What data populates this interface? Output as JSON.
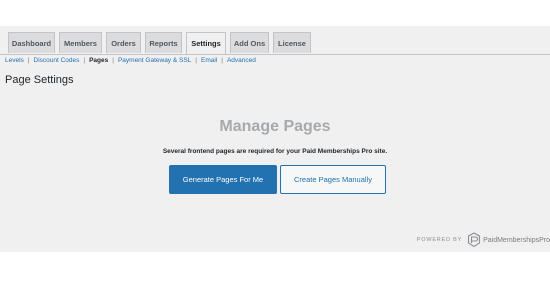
{
  "tabs": [
    {
      "label": "Dashboard",
      "active": false
    },
    {
      "label": "Members",
      "active": false
    },
    {
      "label": "Orders",
      "active": false
    },
    {
      "label": "Reports",
      "active": false
    },
    {
      "label": "Settings",
      "active": true
    },
    {
      "label": "Add Ons",
      "active": false
    },
    {
      "label": "License",
      "active": false
    }
  ],
  "subnav": {
    "items": [
      "Levels",
      "Discount Codes",
      "Pages",
      "Payment Gateway & SSL",
      "Email",
      "Advanced"
    ],
    "current": "Pages",
    "separator": "|"
  },
  "page_title": "Page Settings",
  "manage": {
    "heading": "Manage Pages",
    "description": "Several frontend pages are required for your Paid Memberships Pro site.",
    "primary_button": "Generate Pages For Me",
    "secondary_button": "Create Pages Manually"
  },
  "footer": {
    "powered_by": "POWERED BY",
    "logo_text": "PaidMembershipsPro",
    "logo_icon": "pmpro-logo-icon"
  },
  "colors": {
    "accent": "#2271b1",
    "background": "#f0f0f1",
    "muted_heading": "#a7aaad"
  }
}
